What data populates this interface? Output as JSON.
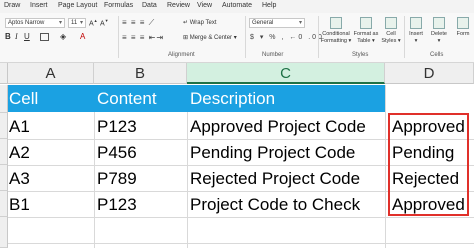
{
  "ribbon_tabs": [
    "Draw",
    "Insert",
    "Page Layout",
    "Formulas",
    "Data",
    "Review",
    "View",
    "Automate",
    "Help"
  ],
  "active_tab_index": -1,
  "font": {
    "name": "Aptos Narrow",
    "size": "11"
  },
  "alignment": {
    "wrap_text": "Wrap Text",
    "merge_center": "Merge & Center"
  },
  "number": {
    "format": "General",
    "symbols": "$ ▾ %  ,  ←0 .00"
  },
  "groups": {
    "alignment": "Alignment",
    "number": "Number",
    "styles": "Styles",
    "cells": "Cells"
  },
  "styles_buttons": [
    {
      "label_top": "Conditional",
      "label_bottom": "Formatting ▾"
    },
    {
      "label_top": "Format as",
      "label_bottom": "Table ▾"
    },
    {
      "label_top": "Cell",
      "label_bottom": "Styles ▾"
    }
  ],
  "cells_buttons": [
    {
      "label_top": "Insert",
      "label_bottom": "▾"
    },
    {
      "label_top": "Delete",
      "label_bottom": "▾"
    },
    {
      "label_top": "Form",
      "label_bottom": ""
    }
  ],
  "columns": [
    "A",
    "B",
    "C",
    "D"
  ],
  "selected_column": "C",
  "table": {
    "headers": [
      "Cell",
      "Content",
      "Description"
    ],
    "rows": [
      {
        "cell": "A1",
        "content": "P123",
        "description": "Approved Project Code",
        "result": "Approved"
      },
      {
        "cell": "A2",
        "content": "P456",
        "description": "Pending Project Code",
        "result": "Pending"
      },
      {
        "cell": "A3",
        "content": "P789",
        "description": "Rejected Project Code",
        "result": "Rejected"
      },
      {
        "cell": "B1",
        "content": "P123",
        "description": "Project Code to Check",
        "result": "Approved"
      }
    ]
  },
  "colors": {
    "header_fill": "#1ba1e2",
    "highlight_border": "#e0302a",
    "excel_green": "#1e7145"
  }
}
